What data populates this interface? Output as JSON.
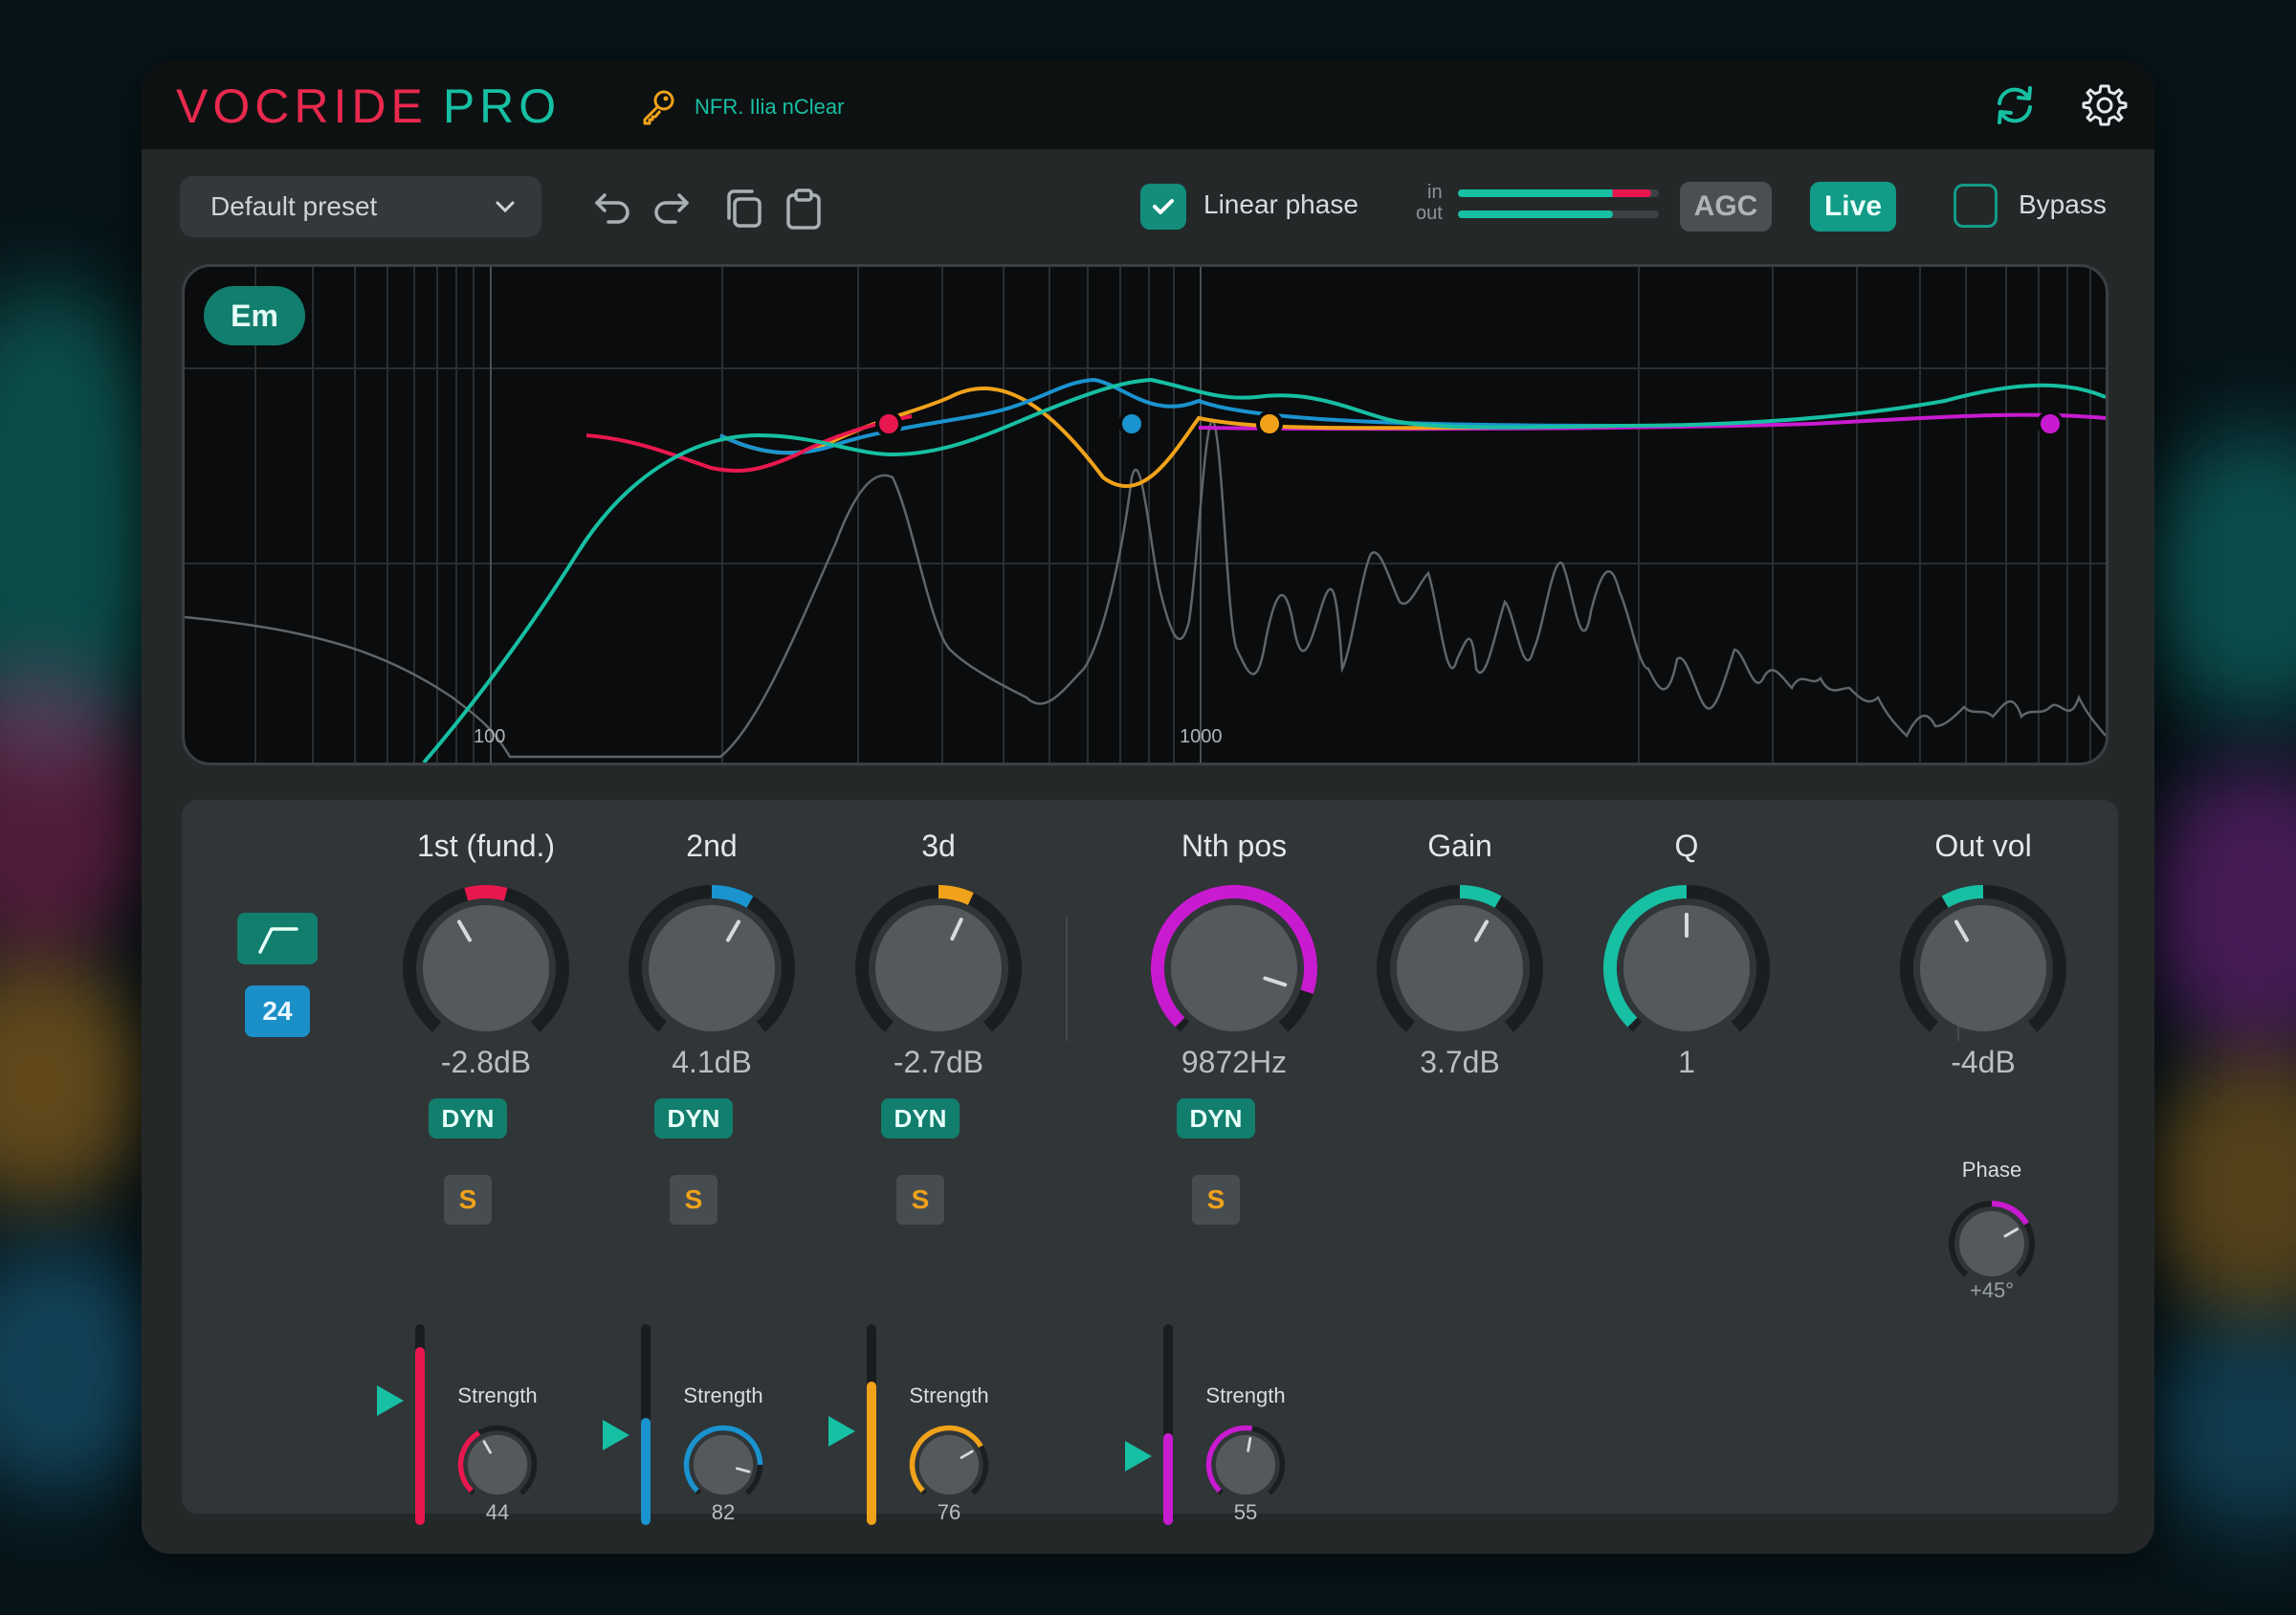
{
  "app": {
    "logo_part1": "VOCRIDE",
    "logo_part2": "PRO",
    "license_text": "NFR. Ilia nClear"
  },
  "toolbar": {
    "preset": "Default preset",
    "linear_phase_label": "Linear phase",
    "linear_phase_checked": true,
    "meter_in_label": "in",
    "meter_out_label": "out",
    "meter_in_level": 0.96,
    "meter_out_level": 0.77,
    "agc_label": "AGC",
    "live_label": "Live",
    "bypass_label": "Bypass",
    "bypass_checked": false
  },
  "eq": {
    "note_badge": "Em",
    "freq_labels": [
      "100",
      "1000"
    ],
    "colors": {
      "fund": "#e8184f",
      "second": "#1a93cf",
      "third": "#f0a21a",
      "nth": "#c81bd0",
      "accent": "#17bfa3"
    }
  },
  "filter": {
    "slope_icon": "highpass-slope-icon",
    "order": "24"
  },
  "bands": [
    {
      "title": "1st (fund.)",
      "value": "-2.8dB",
      "dyn": "DYN",
      "solo": "S",
      "strength_label": "Strength",
      "strength": "44",
      "color": "#e8184f"
    },
    {
      "title": "2nd",
      "value": "4.1dB",
      "dyn": "DYN",
      "solo": "S",
      "strength_label": "Strength",
      "strength": "82",
      "color": "#1a93cf"
    },
    {
      "title": "3d",
      "value": "-2.7dB",
      "dyn": "DYN",
      "solo": "S",
      "strength_label": "Strength",
      "strength": "76",
      "color": "#f0a21a"
    },
    {
      "title": "Nth pos",
      "value": "9872Hz",
      "dyn": "DYN",
      "solo": "S",
      "strength_label": "Strength",
      "strength": "55",
      "color": "#c81bd0"
    }
  ],
  "globals": [
    {
      "title": "Gain",
      "value": "3.7dB"
    },
    {
      "title": "Q",
      "value": "1"
    },
    {
      "title": "Out vol",
      "value": "-4dB"
    }
  ],
  "phase": {
    "label": "Phase",
    "value": "+45°"
  }
}
